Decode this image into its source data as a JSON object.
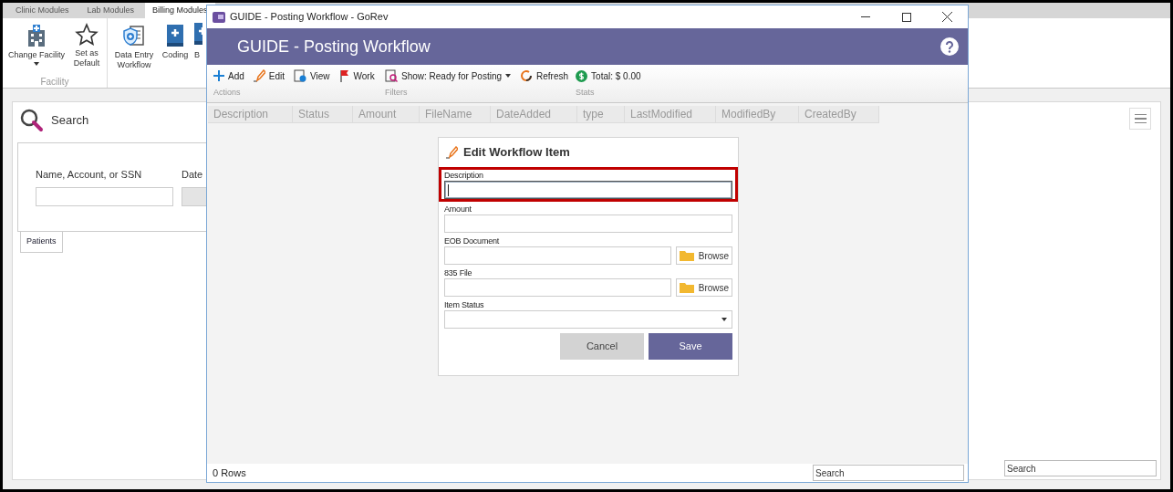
{
  "background_app": {
    "tabs": [
      {
        "label": "Clinic Modules",
        "selected": false
      },
      {
        "label": "Lab Modules",
        "selected": false
      },
      {
        "label": "Billing Modules",
        "selected": true
      }
    ],
    "ribbon_groups": [
      {
        "label": "Facility",
        "items": [
          {
            "label": "Change Facility",
            "dropdown": true
          },
          {
            "label": "Set as Default",
            "dropdown": false
          }
        ]
      },
      {
        "items": [
          {
            "label": "Data Entry Workflow",
            "dropdown": false
          },
          {
            "label": "Coding",
            "dropdown": false
          },
          {
            "label": "B",
            "dropdown": false
          }
        ]
      }
    ],
    "search_panel": {
      "title": "Search",
      "fields": [
        {
          "label": "Name, Account, or SSN",
          "disabled": false
        },
        {
          "label": "Date",
          "disabled": true
        }
      ],
      "tabs": [
        {
          "label": "Patients",
          "selected": true
        }
      ]
    },
    "search_field": {
      "placeholder": "Search"
    }
  },
  "window": {
    "title": "GUIDE - Posting Workflow - GoRev",
    "header": "GUIDE - Posting Workflow",
    "toolbar_groups": [
      {
        "label": "Actions",
        "items": [
          {
            "label": "Add",
            "kind": "add"
          },
          {
            "label": "Edit",
            "kind": "edit"
          },
          {
            "label": "View",
            "kind": "view"
          },
          {
            "label": "Work",
            "kind": "flag"
          }
        ]
      },
      {
        "label": "Filters",
        "items": [
          {
            "label": "Show: Ready for Posting",
            "kind": "filter"
          },
          {
            "label": "Refresh",
            "kind": "refresh"
          }
        ]
      },
      {
        "label": "Stats",
        "items": [
          {
            "label": "Total: $ 0.00",
            "kind": "money"
          }
        ]
      }
    ],
    "columns": [
      "Description",
      "Status",
      "Amount",
      "FileName",
      "DateAdded",
      "type",
      "LastModified",
      "ModifiedBy",
      "CreatedBy"
    ],
    "dialog": {
      "title": "Edit Workflow Item",
      "fields": [
        {
          "label": "Description",
          "kind": "text",
          "highlighted": true,
          "focused": true
        },
        {
          "label": "Amount",
          "kind": "text",
          "highlighted": false,
          "focused": false
        },
        {
          "label": "EOB Document",
          "kind": "file",
          "button": "Browse",
          "highlighted": false,
          "focused": false
        },
        {
          "label": "835 File",
          "kind": "file",
          "button": "Browse",
          "highlighted": false,
          "focused": false
        },
        {
          "label": "Item Status",
          "kind": "select",
          "highlighted": false,
          "focused": false
        }
      ],
      "buttons": [
        {
          "label": "Cancel",
          "kind": "secondary"
        },
        {
          "label": "Save",
          "kind": "primary"
        }
      ]
    },
    "status_bar": {
      "rows": "0 Rows",
      "search_placeholder": "Search"
    }
  }
}
